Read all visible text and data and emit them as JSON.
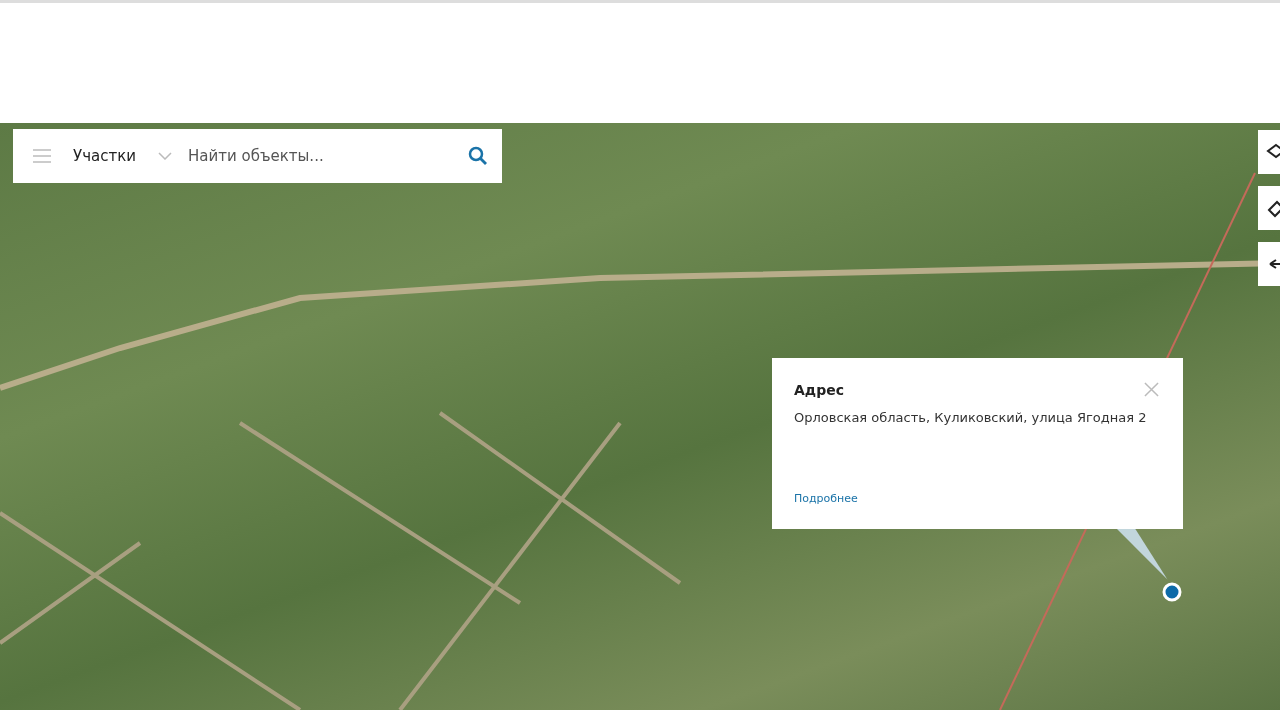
{
  "search": {
    "category": "Участки",
    "placeholder": "Найти объекты..."
  },
  "popup": {
    "title": "Адрес",
    "address": "Орловская область, Куликовский, улица Ягодная 2",
    "link": "Подробнее"
  }
}
